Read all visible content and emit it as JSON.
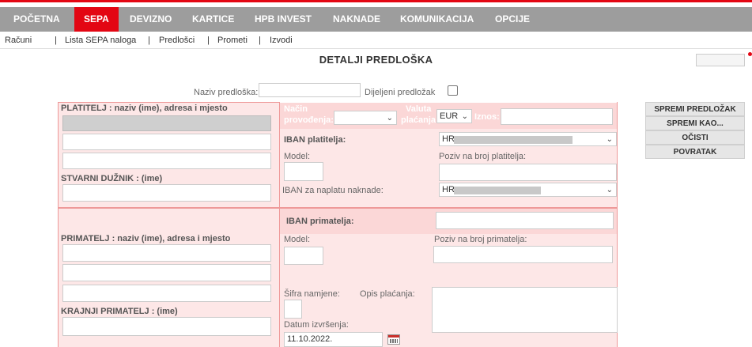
{
  "nav": {
    "tabs": [
      {
        "label": "POČETNA"
      },
      {
        "label": "SEPA"
      },
      {
        "label": "DEVIZNO"
      },
      {
        "label": "KARTICE"
      },
      {
        "label": "HPB INVEST"
      },
      {
        "label": "NAKNADE"
      },
      {
        "label": "KOMUNIKACIJA"
      },
      {
        "label": "OPCIJE"
      }
    ],
    "active": "SEPA"
  },
  "subnav": {
    "items": [
      "Računi",
      "Lista SEPA naloga",
      "Predlošci",
      "Prometi",
      "Izvodi"
    ],
    "separator": "|"
  },
  "page": {
    "title": "DETALJI PREDLOŠKA"
  },
  "template": {
    "name_label": "Naziv predloška:",
    "name_value": "",
    "shared_label": "Dijeljeni predložak",
    "shared_checked": false
  },
  "payer": {
    "header": "PLATITELJ : naziv (ime), adresa i mjesto",
    "actual_debtor_label": "STVARNI DUŽNIK : (ime)"
  },
  "execution": {
    "method_label_1": "Način",
    "method_label_2": "provođenja:",
    "method_value": "",
    "currency_label_1": "Valuta",
    "currency_label_2": "plaćanja:",
    "currency_value": "EUR",
    "amount_label": "Iznos:",
    "amount_value": ""
  },
  "payer_iban": {
    "label": "IBAN platitelja:",
    "value": "HR",
    "model_label": "Model:",
    "reference_label": "Poziv na broj platitelja:",
    "fee_iban_label": "IBAN za naplatu naknade:",
    "fee_iban_value": "HR"
  },
  "recipient": {
    "header": "PRIMATELJ : naziv (ime), adresa i mjesto",
    "final_recipient_label": "KRAJNJI PRIMATELJ : (ime)",
    "iban_label": "IBAN primatelja:",
    "model_label": "Model:",
    "reference_label": "Poziv na broj primatelja:",
    "purpose_code_label": "Šifra namjene:",
    "description_label": "Opis plaćanja:",
    "date_label": "Datum izvršenja:",
    "date_value": "11.10.2022."
  },
  "actions": {
    "save": "SPREMI PREDLOŽAK",
    "save_as": "SPREMI KAO...",
    "clear": "OČISTI",
    "back": "POVRATAK"
  },
  "colors": {
    "brand_red": "#e30613",
    "nav_grey": "#9d9d9d",
    "panel_left": "#fde7e7",
    "panel_right": "#fbd7d7"
  }
}
